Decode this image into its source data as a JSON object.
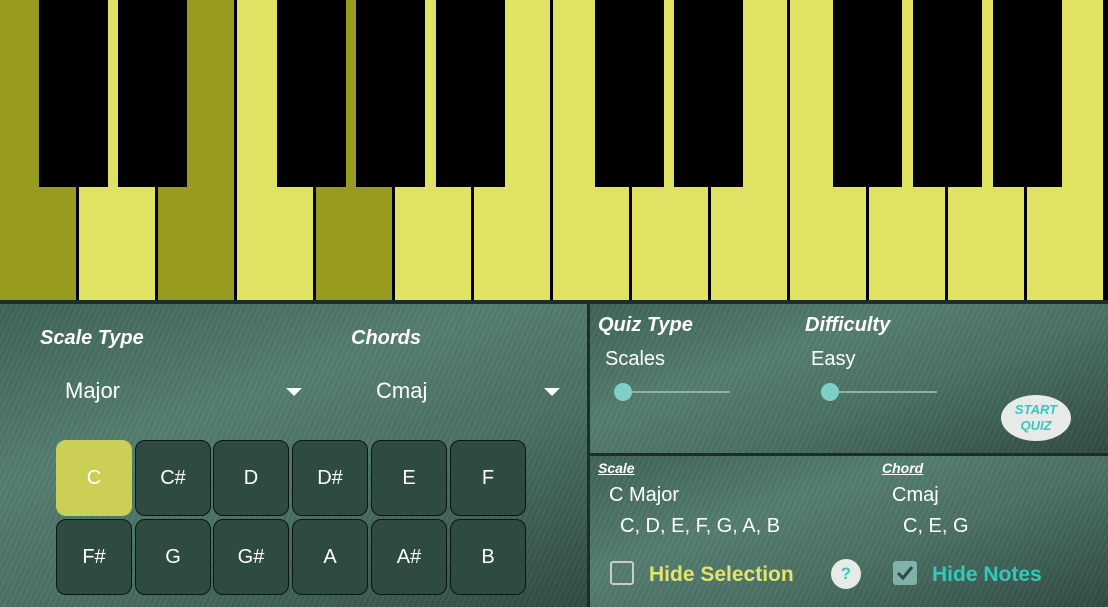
{
  "keyboard": {
    "white_keys": [
      "C",
      "D",
      "E",
      "F",
      "G",
      "A",
      "B",
      "C",
      "D",
      "E",
      "F",
      "G",
      "A",
      "B",
      "C"
    ],
    "highlighted_white_keys": [
      "C",
      "E",
      "G"
    ]
  },
  "left_panel": {
    "scale_type_label": "Scale Type",
    "scale_type_value": "Major",
    "chords_label": "Chords",
    "chords_value": "Cmaj",
    "notes": [
      "C",
      "C#",
      "D",
      "D#",
      "E",
      "F",
      "F#",
      "G",
      "G#",
      "A",
      "A#",
      "B"
    ],
    "selected_note": "C"
  },
  "quiz": {
    "quiz_type_label": "Quiz Type",
    "quiz_type_value": "Scales",
    "difficulty_label": "Difficulty",
    "difficulty_value": "Easy",
    "start_line1": "START",
    "start_line2": "QUIZ"
  },
  "info": {
    "scale_label": "Scale",
    "scale_name": "C Major",
    "scale_notes": "C, D, E, F, G, A, B",
    "chord_label": "Chord",
    "chord_name": "Cmaj",
    "chord_notes": "C, E, G",
    "hide_selection_label": "Hide Selection",
    "hide_selection_checked": false,
    "help_label": "?",
    "hide_notes_label": "Hide Notes",
    "hide_notes_checked": true
  },
  "colors": {
    "white_key": "#dfe263",
    "highlight_key": "#979b20",
    "selected_note": "#cccf55",
    "hide_selection_text": "#e3e56a",
    "hide_notes_text": "#33c8bc"
  }
}
